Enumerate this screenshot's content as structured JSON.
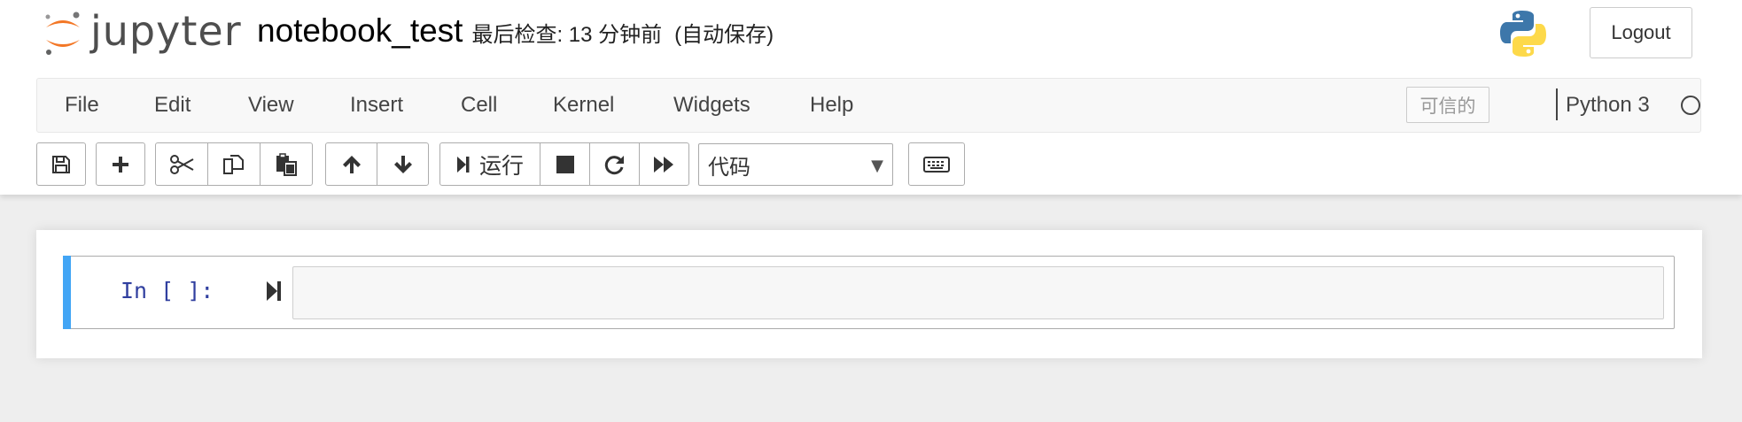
{
  "header": {
    "logo_text": "jupyter",
    "notebook_name": "notebook_test",
    "checkpoint_status": "最后检查: 13 分钟前",
    "autosave_status": "(自动保存)",
    "logout_label": "Logout"
  },
  "menubar": {
    "items": [
      {
        "label": "File"
      },
      {
        "label": "Edit"
      },
      {
        "label": "View"
      },
      {
        "label": "Insert"
      },
      {
        "label": "Cell"
      },
      {
        "label": "Kernel"
      },
      {
        "label": "Widgets"
      },
      {
        "label": "Help"
      }
    ],
    "trusted_label": "可信的",
    "kernel_name": "Python 3",
    "kernel_status": "idle"
  },
  "toolbar": {
    "buttons": [
      {
        "name": "save",
        "icon": "save-icon"
      },
      {
        "name": "insert-cell-below",
        "icon": "plus-icon"
      },
      {
        "name": "cut-cells",
        "icon": "scissors-icon"
      },
      {
        "name": "copy-cells",
        "icon": "copy-icon"
      },
      {
        "name": "paste-cells",
        "icon": "paste-icon"
      },
      {
        "name": "move-cell-up",
        "icon": "arrow-up-icon"
      },
      {
        "name": "move-cell-down",
        "icon": "arrow-down-icon"
      },
      {
        "name": "run",
        "icon": "step-forward-icon"
      },
      {
        "name": "interrupt-kernel",
        "icon": "stop-icon"
      },
      {
        "name": "restart-kernel",
        "icon": "repeat-icon"
      },
      {
        "name": "restart-run-all",
        "icon": "fast-forward-icon"
      },
      {
        "name": "command-palette",
        "icon": "keyboard-icon"
      }
    ],
    "run_label": "运行",
    "cell_type": "代码"
  },
  "notebook": {
    "cells": [
      {
        "prompt": "In [ ]:",
        "source": ""
      }
    ]
  },
  "colors": {
    "accent_cell_bar": "#42a5f5",
    "prompt_color": "#303f9f",
    "jupyter_orange": "#f37726"
  }
}
